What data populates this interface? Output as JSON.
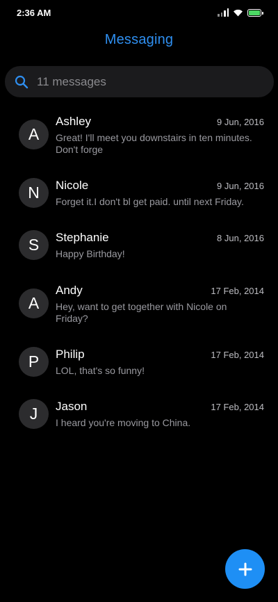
{
  "status_bar": {
    "time": "2:36 AM",
    "icons": [
      "signal-icon",
      "wifi-icon",
      "battery-icon"
    ],
    "battery_color": "#4cd964"
  },
  "header": {
    "title": "Messaging",
    "title_color": "#2f8ff0"
  },
  "search": {
    "placeholder": "11 messages",
    "icon": "search-icon"
  },
  "messages": [
    {
      "initial": "A",
      "sender": "Ashley",
      "date": "9 Jun, 2016",
      "snippet": "Great! I'll meet you downstairs in ten minutes. Don't forge"
    },
    {
      "initial": "N",
      "sender": "Nicole",
      "date": "9 Jun, 2016",
      "snippet": "Forget it.I don't bl get paid. until next Friday."
    },
    {
      "initial": "S",
      "sender": "Stephanie",
      "date": "8 Jun, 2016",
      "snippet": "Happy Birthday!"
    },
    {
      "initial": "A",
      "sender": "Andy",
      "date": "17 Feb, 2014",
      "snippet": "Hey, want to get together with Nicole on Friday?"
    },
    {
      "initial": "P",
      "sender": "Philip",
      "date": "17 Feb, 2014",
      "snippet": "LOL, that's so funny!"
    },
    {
      "initial": "J",
      "sender": "Jason",
      "date": "17 Feb, 2014",
      "snippet": "I heard you're moving to China."
    }
  ],
  "fab": {
    "icon": "plus-icon",
    "color": "#1e8ff5"
  }
}
